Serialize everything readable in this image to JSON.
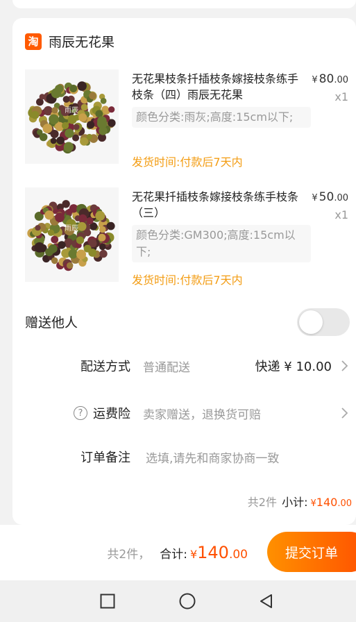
{
  "shop": {
    "logo_text": "淘",
    "name": "雨辰无花果",
    "logo_color": "#ff5a00"
  },
  "items": [
    {
      "title": "无花果枝条扦插枝条嫁接枝条练手枝条（四）雨辰无花果",
      "price_symbol": "¥",
      "price_int": "80",
      "price_dec": ".00",
      "qty": "x1",
      "spec": "颜色分类:雨灰;高度:15cm以下;",
      "ship_time": "发货时间:付款后7天内",
      "thumb_watermark": "雨辰"
    },
    {
      "title": "无花果扦插枝条嫁接枝条练手枝条（三）",
      "price_symbol": "¥",
      "price_int": "50",
      "price_dec": ".00",
      "qty": "x1",
      "spec": "颜色分类:GM300;高度:15cm以下;",
      "ship_time": "发货时间:付款后7天内",
      "thumb_watermark": "雨辰"
    }
  ],
  "gift": {
    "label": "赠送他人",
    "enabled": false
  },
  "delivery": {
    "label": "配送方式",
    "value": "普通配送",
    "right": "快递 ¥ 10.00"
  },
  "insurance": {
    "help_icon": "?",
    "label": "运费险",
    "value": "卖家赠送，退换货可赔"
  },
  "note": {
    "label": "订单备注",
    "placeholder": "选填,请先和商家协商一致"
  },
  "subtotal": {
    "count": "共2件",
    "label": "小计:",
    "symbol": "¥",
    "amount": "140",
    "cents": ".00"
  },
  "footer": {
    "count": "共2件，",
    "label": "合计:",
    "symbol": "¥",
    "amount": "140",
    "cents": ".00",
    "submit": "提交订单"
  },
  "colors": {
    "accent": "#ff5000",
    "ship_time": "#f39c12",
    "muted": "#999999"
  }
}
